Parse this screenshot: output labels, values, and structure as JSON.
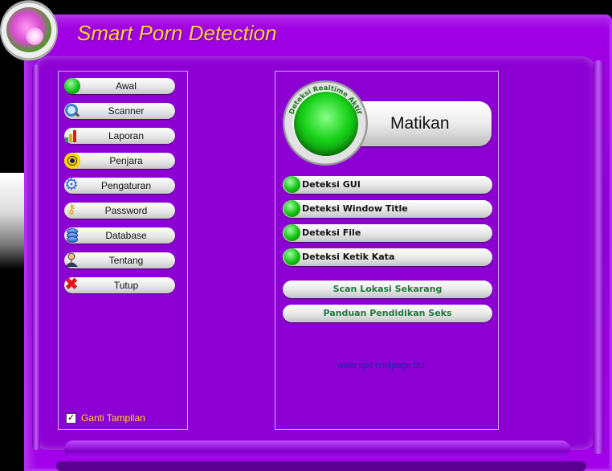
{
  "app": {
    "title": "Smart Porn Detection"
  },
  "sidebar": {
    "items": [
      {
        "label": "Awal",
        "icon": "green-dot-icon"
      },
      {
        "label": "Scanner",
        "icon": "magnifier-icon"
      },
      {
        "label": "Laporan",
        "icon": "bar-chart-icon"
      },
      {
        "label": "Penjara",
        "icon": "radiation-icon"
      },
      {
        "label": "Pengaturan",
        "icon": "gear-icon"
      },
      {
        "label": "Password",
        "icon": "key-icon"
      },
      {
        "label": "Database",
        "icon": "database-icon"
      },
      {
        "label": "Tentang",
        "icon": "person-icon"
      },
      {
        "label": "Tutup",
        "icon": "close-icon"
      }
    ],
    "toggle_skin": {
      "label": "Ganti Tampilan",
      "checked": true
    }
  },
  "main": {
    "realtime": {
      "status_label": "Deteksi Realtime Aktif",
      "action_label": "Matikan"
    },
    "detections": [
      {
        "label": "Deteksi GUI",
        "on": true
      },
      {
        "label": "Deteksi Window Title",
        "on": true
      },
      {
        "label": "Deteksi File",
        "on": true
      },
      {
        "label": "Deteksi Ketik Kata",
        "on": true
      }
    ],
    "actions": {
      "scan_label": "Scan Lokasi Sekarang",
      "guide_label": "Panduan Pendidikan Seks"
    },
    "website": "www.spd.coolpage.biz"
  },
  "colors": {
    "frame": "#9a00e0",
    "title": "#ffd23a",
    "active_green": "#19d219",
    "link_blue": "#1a2aa0"
  }
}
